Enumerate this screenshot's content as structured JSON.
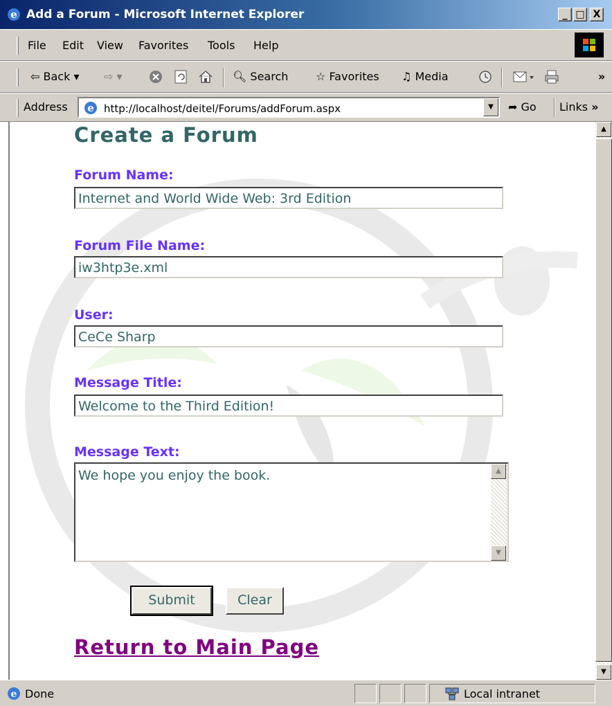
{
  "window": {
    "title": "Add a Forum - Microsoft Internet Explorer",
    "minimize_label": "_",
    "maximize_label": "□",
    "close_label": "X"
  },
  "menubar": {
    "items": [
      "File",
      "Edit",
      "View",
      "Favorites",
      "Tools",
      "Help"
    ]
  },
  "toolbar": {
    "back_label": "Back",
    "back_glyph": "⇦",
    "forward_glyph": "⇨",
    "search_label": "Search",
    "favorites_label": "Favorites",
    "media_label": "Media",
    "overflow_glyph": "»"
  },
  "addressbar": {
    "label": "Address",
    "url": "http://localhost/deitel/Forums/addForum.aspx",
    "go_label": "Go",
    "links_label": "Links"
  },
  "page": {
    "heading": "Create a Forum",
    "forum_name_label": "Forum Name:",
    "forum_name_value": "Internet and World Wide Web: 3rd Edition",
    "file_name_label": "Forum File Name:",
    "file_name_value": "iw3htp3e.xml",
    "user_label": "User:",
    "user_value": "CeCe Sharp",
    "message_title_label": "Message Title:",
    "message_title_value": "Welcome to the Third Edition!",
    "message_text_label": "Message Text:",
    "message_text_value": "We hope you enjoy the book.",
    "submit_label": "Submit",
    "clear_label": "Clear",
    "return_link": "Return to Main Page"
  },
  "statusbar": {
    "status": "Done",
    "zone": "Local intranet"
  },
  "colors": {
    "heading": "#336666",
    "label": "#6633ff",
    "link": "#800080",
    "input_text": "#336666",
    "titlebar": "#0a246a"
  },
  "icons": [
    "ie-logo-icon",
    "windows-logo-icon",
    "stop-icon",
    "refresh-icon",
    "home-icon",
    "search-icon",
    "favorites-icon",
    "media-icon",
    "history-icon",
    "mail-icon",
    "print-icon",
    "page-icon",
    "go-arrow-icon",
    "intranet-icon"
  ]
}
